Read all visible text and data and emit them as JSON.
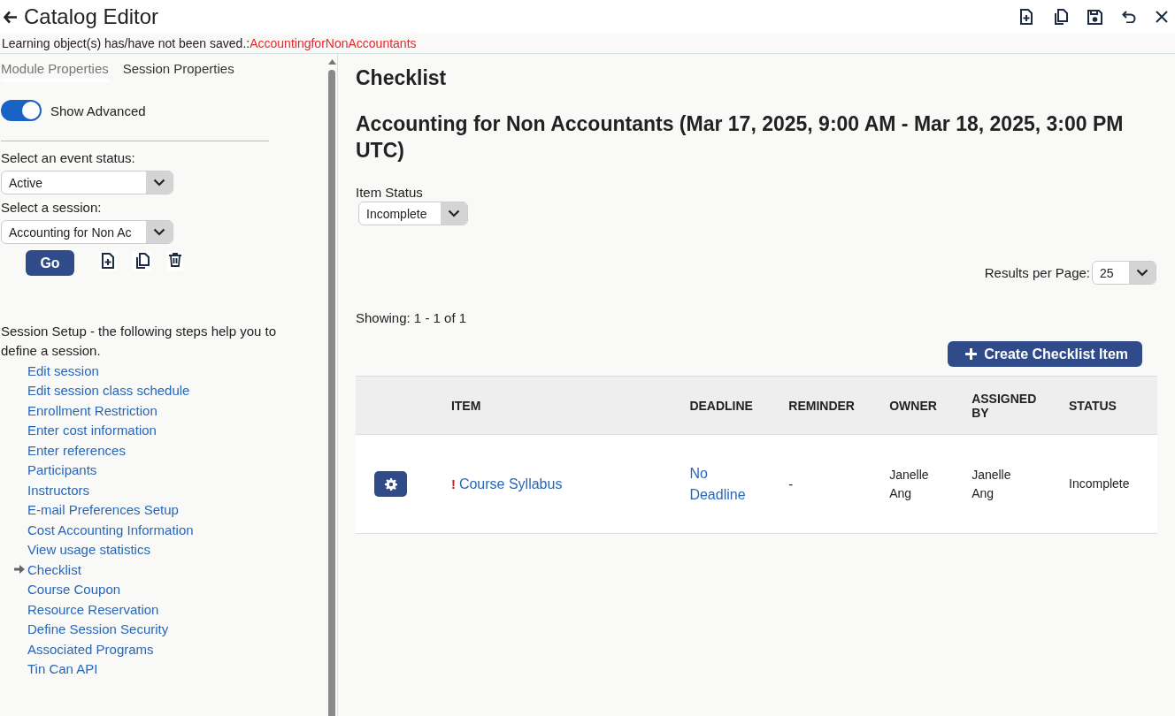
{
  "window": {
    "title": "Catalog Editor"
  },
  "toolbar": {
    "buttons": [
      {
        "kind": "new"
      },
      {
        "kind": "copy"
      },
      {
        "kind": "save"
      },
      {
        "kind": "undo"
      },
      {
        "kind": "close"
      }
    ]
  },
  "notice": {
    "text": "Learning object(s) has/have not been saved.:",
    "object": "AccountingforNonAccountants"
  },
  "sidebar": {
    "tabs": [
      {
        "label": "Module Properties",
        "selected": true
      },
      {
        "label": "Session Properties",
        "selected": false
      }
    ],
    "show_advanced": {
      "label": "Show Advanced",
      "on": true
    },
    "event_status": {
      "label": "Select an event status:",
      "value": "Active"
    },
    "session": {
      "label": "Select a session:",
      "value": "Accounting for Non Ac"
    },
    "go_button": "Go",
    "session_actions": [
      {
        "kind": "new"
      },
      {
        "kind": "copy"
      },
      {
        "kind": "delete"
      }
    ],
    "setup_intro": "Session Setup - the following steps help you to define a session.",
    "steps": [
      {
        "label": "Edit session",
        "selected": false
      },
      {
        "label": "Edit session class schedule",
        "selected": false
      },
      {
        "label": "Enrollment Restriction",
        "selected": false
      },
      {
        "label": "Enter cost information",
        "selected": false
      },
      {
        "label": "Enter references",
        "selected": false
      },
      {
        "label": "Participants",
        "selected": false
      },
      {
        "label": "Instructors",
        "selected": false
      },
      {
        "label": "E-mail Preferences Setup",
        "selected": false
      },
      {
        "label": "Cost Accounting Information",
        "selected": false
      },
      {
        "label": "View usage statistics",
        "selected": false
      },
      {
        "label": "Checklist",
        "selected": true
      },
      {
        "label": "Course Coupon",
        "selected": false
      },
      {
        "label": "Resource Reservation",
        "selected": false
      },
      {
        "label": "Define Session Security",
        "selected": false
      },
      {
        "label": "Associated Programs",
        "selected": false
      },
      {
        "label": "Tin Can API",
        "selected": false
      }
    ]
  },
  "main": {
    "heading": "Checklist",
    "session_title": "Accounting for Non Accountants (Mar 17, 2025, 9:00 AM - Mar 18, 2025, 3:00 PM UTC)",
    "item_status": {
      "label": "Item Status",
      "value": "Incomplete"
    },
    "results_per_page": {
      "label": "Results per Page:",
      "value": "25"
    },
    "showing": "Showing: 1 - 1 of 1",
    "create_button": "Create Checklist Item",
    "table": {
      "columns": [
        "ITEM",
        "DEADLINE",
        "REMINDER",
        "OWNER",
        "ASSIGNED BY",
        "STATUS"
      ],
      "rows": [
        {
          "flag": "!",
          "item": "Course Syllabus",
          "deadline": "No Deadline",
          "reminder": "-",
          "owner": "Janelle Ang",
          "assigned_by": "Janelle Ang",
          "status": "Incomplete"
        }
      ]
    }
  }
}
